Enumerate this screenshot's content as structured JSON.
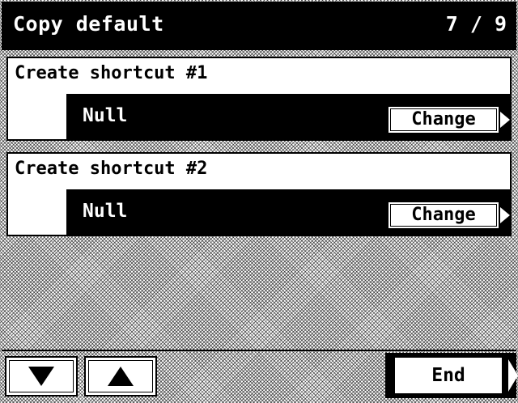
{
  "header": {
    "title": "Copy default",
    "page_indicator": "7 / 9"
  },
  "settings": [
    {
      "label": "Create shortcut #1",
      "value": "Null",
      "button_label": "Change"
    },
    {
      "label": "Create shortcut #2",
      "value": "Null",
      "button_label": "Change"
    }
  ],
  "footer": {
    "down_icon": "down-triangle-icon",
    "up_icon": "up-triangle-icon",
    "end_label": "End"
  },
  "colors": {
    "foreground": "#000000",
    "background": "#ffffff"
  }
}
